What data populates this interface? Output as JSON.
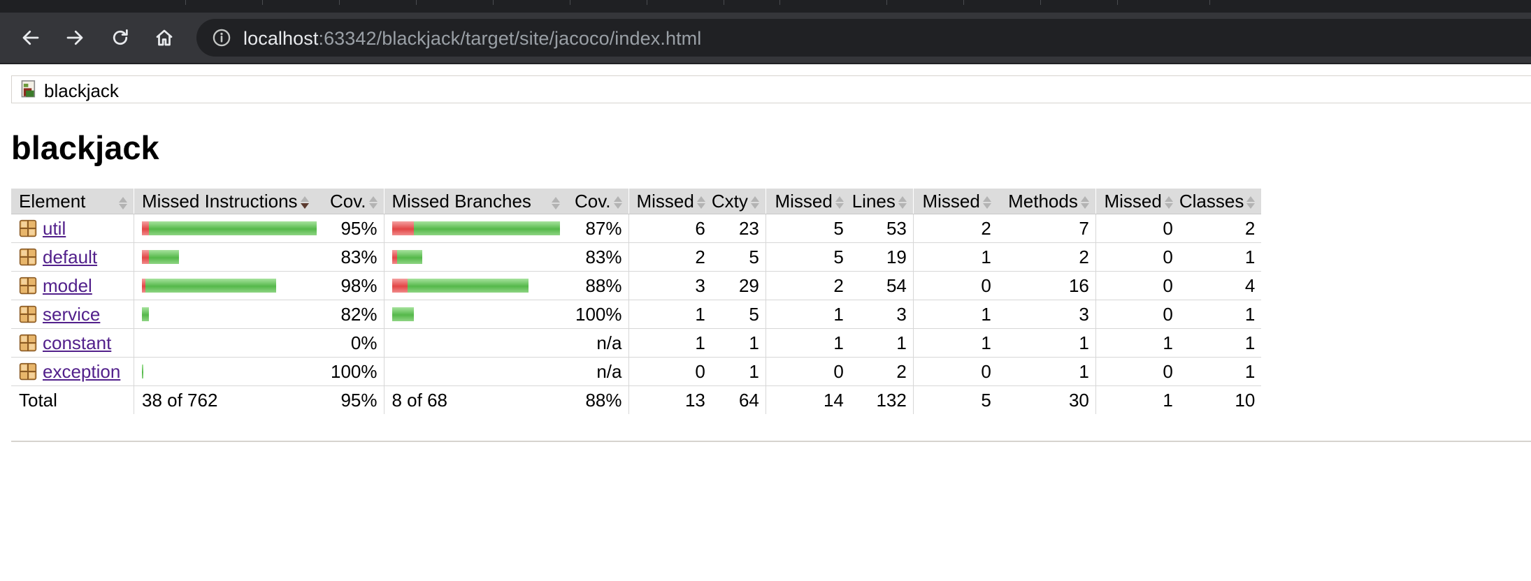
{
  "browser": {
    "url_host": "localhost",
    "url_rest": ":63342/blackjack/target/site/jacoco/index.html"
  },
  "breadcrumb": {
    "label": "blackjack"
  },
  "page_title": "blackjack",
  "table": {
    "headers": [
      "Element",
      "Missed Instructions",
      "Cov.",
      "Missed Branches",
      "Cov.",
      "Missed",
      "Cxty",
      "Missed",
      "Lines",
      "Missed",
      "Methods",
      "Missed",
      "Classes"
    ],
    "rows": [
      {
        "name": "util",
        "instr_bar": {
          "missed": 0.04,
          "covered": 1.0
        },
        "instr_cov": "95%",
        "branch_bar": {
          "missed": 0.13,
          "covered": 0.87
        },
        "branch_cov": "87%",
        "missed_cxty": "6",
        "cxty": "23",
        "missed_lines": "5",
        "lines": "53",
        "missed_methods": "2",
        "methods": "7",
        "missed_classes": "0",
        "classes": "2"
      },
      {
        "name": "default",
        "instr_bar": {
          "missed": 0.04,
          "covered": 0.18
        },
        "instr_cov": "83%",
        "branch_bar": {
          "missed": 0.03,
          "covered": 0.15
        },
        "branch_cov": "83%",
        "missed_cxty": "2",
        "cxty": "5",
        "missed_lines": "5",
        "lines": "19",
        "missed_methods": "1",
        "methods": "2",
        "missed_classes": "0",
        "classes": "1"
      },
      {
        "name": "model",
        "instr_bar": {
          "missed": 0.02,
          "covered": 0.78
        },
        "instr_cov": "98%",
        "branch_bar": {
          "missed": 0.09,
          "covered": 0.72
        },
        "branch_cov": "88%",
        "missed_cxty": "3",
        "cxty": "29",
        "missed_lines": "2",
        "lines": "54",
        "missed_methods": "0",
        "methods": "16",
        "missed_classes": "0",
        "classes": "4"
      },
      {
        "name": "service",
        "instr_bar": {
          "missed": 0.0,
          "covered": 0.04
        },
        "instr_cov": "82%",
        "branch_bar": {
          "missed": 0.0,
          "covered": 0.13
        },
        "branch_cov": "100%",
        "missed_cxty": "1",
        "cxty": "5",
        "missed_lines": "1",
        "lines": "3",
        "missed_methods": "1",
        "methods": "3",
        "missed_classes": "0",
        "classes": "1"
      },
      {
        "name": "constant",
        "instr_bar": {
          "missed": 0.0,
          "covered": 0.0
        },
        "instr_cov": "0%",
        "branch_bar": {
          "missed": 0.0,
          "covered": 0.0
        },
        "branch_cov": "n/a",
        "missed_cxty": "1",
        "cxty": "1",
        "missed_lines": "1",
        "lines": "1",
        "missed_methods": "1",
        "methods": "1",
        "missed_classes": "1",
        "classes": "1"
      },
      {
        "name": "exception",
        "instr_bar": {
          "missed": 0.0,
          "covered": 0.01
        },
        "instr_cov": "100%",
        "branch_bar": {
          "missed": 0.0,
          "covered": 0.0
        },
        "branch_cov": "n/a",
        "missed_cxty": "0",
        "cxty": "1",
        "missed_lines": "0",
        "lines": "2",
        "missed_methods": "0",
        "methods": "1",
        "missed_classes": "0",
        "classes": "1"
      }
    ],
    "total": {
      "label": "Total",
      "instr": "38 of 762",
      "instr_cov": "95%",
      "branch": "8 of 68",
      "branch_cov": "88%",
      "missed_cxty": "13",
      "cxty": "64",
      "missed_lines": "14",
      "lines": "132",
      "missed_methods": "5",
      "methods": "30",
      "missed_classes": "1",
      "classes": "10"
    }
  },
  "colors": {
    "link": "#52208b",
    "bar_missed": "#e24545",
    "bar_covered": "#55b84a",
    "header_bg": "#dcdcdc",
    "chrome_toolbar": "#35363a"
  },
  "icons": {
    "back": "arrow-left-icon",
    "forward": "arrow-right-icon",
    "reload": "reload-icon",
    "home": "home-icon",
    "site_info": "info-icon",
    "session": "report-icon",
    "package": "package-icon"
  }
}
